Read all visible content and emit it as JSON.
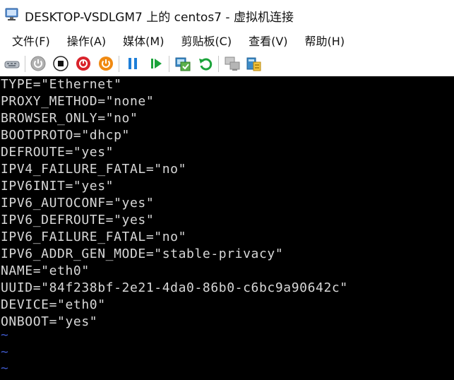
{
  "window": {
    "title": "DESKTOP-VSDLGM7 上的 centos7 - 虚拟机连接"
  },
  "menu": {
    "items": [
      "文件(F)",
      "操作(A)",
      "媒体(M)",
      "剪贴板(C)",
      "查看(V)",
      "帮助(H)"
    ]
  },
  "toolbar": {
    "buttons": [
      "ctrl-alt-del-icon",
      "start-icon",
      "turn-off-icon",
      "shut-down-icon",
      "save-icon",
      "pause-icon",
      "resume-icon",
      "checkpoint-icon",
      "revert-icon",
      "enhanced-session-icon",
      "share-icon"
    ]
  },
  "console": {
    "lines": [
      "TYPE=\"Ethernet\"",
      "PROXY_METHOD=\"none\"",
      "BROWSER_ONLY=\"no\"",
      "BOOTPROTO=\"dhcp\"",
      "DEFROUTE=\"yes\"",
      "IPV4_FAILURE_FATAL=\"no\"",
      "IPV6INIT=\"yes\"",
      "IPV6_AUTOCONF=\"yes\"",
      "IPV6_DEFROUTE=\"yes\"",
      "IPV6_FAILURE_FATAL=\"no\"",
      "IPV6_ADDR_GEN_MODE=\"stable-privacy\"",
      "NAME=\"eth0\"",
      "UUID=\"84f238bf-2e21-4da0-86b0-c6bc9a90642c\"",
      "DEVICE=\"eth0\"",
      "ONBOOT=\"yes\""
    ],
    "empty_markers": [
      "~",
      "~",
      "~"
    ]
  },
  "colors": {
    "console_bg": "#000000",
    "console_fg": "#d8d8d8",
    "tilde": "#3e58c8"
  }
}
